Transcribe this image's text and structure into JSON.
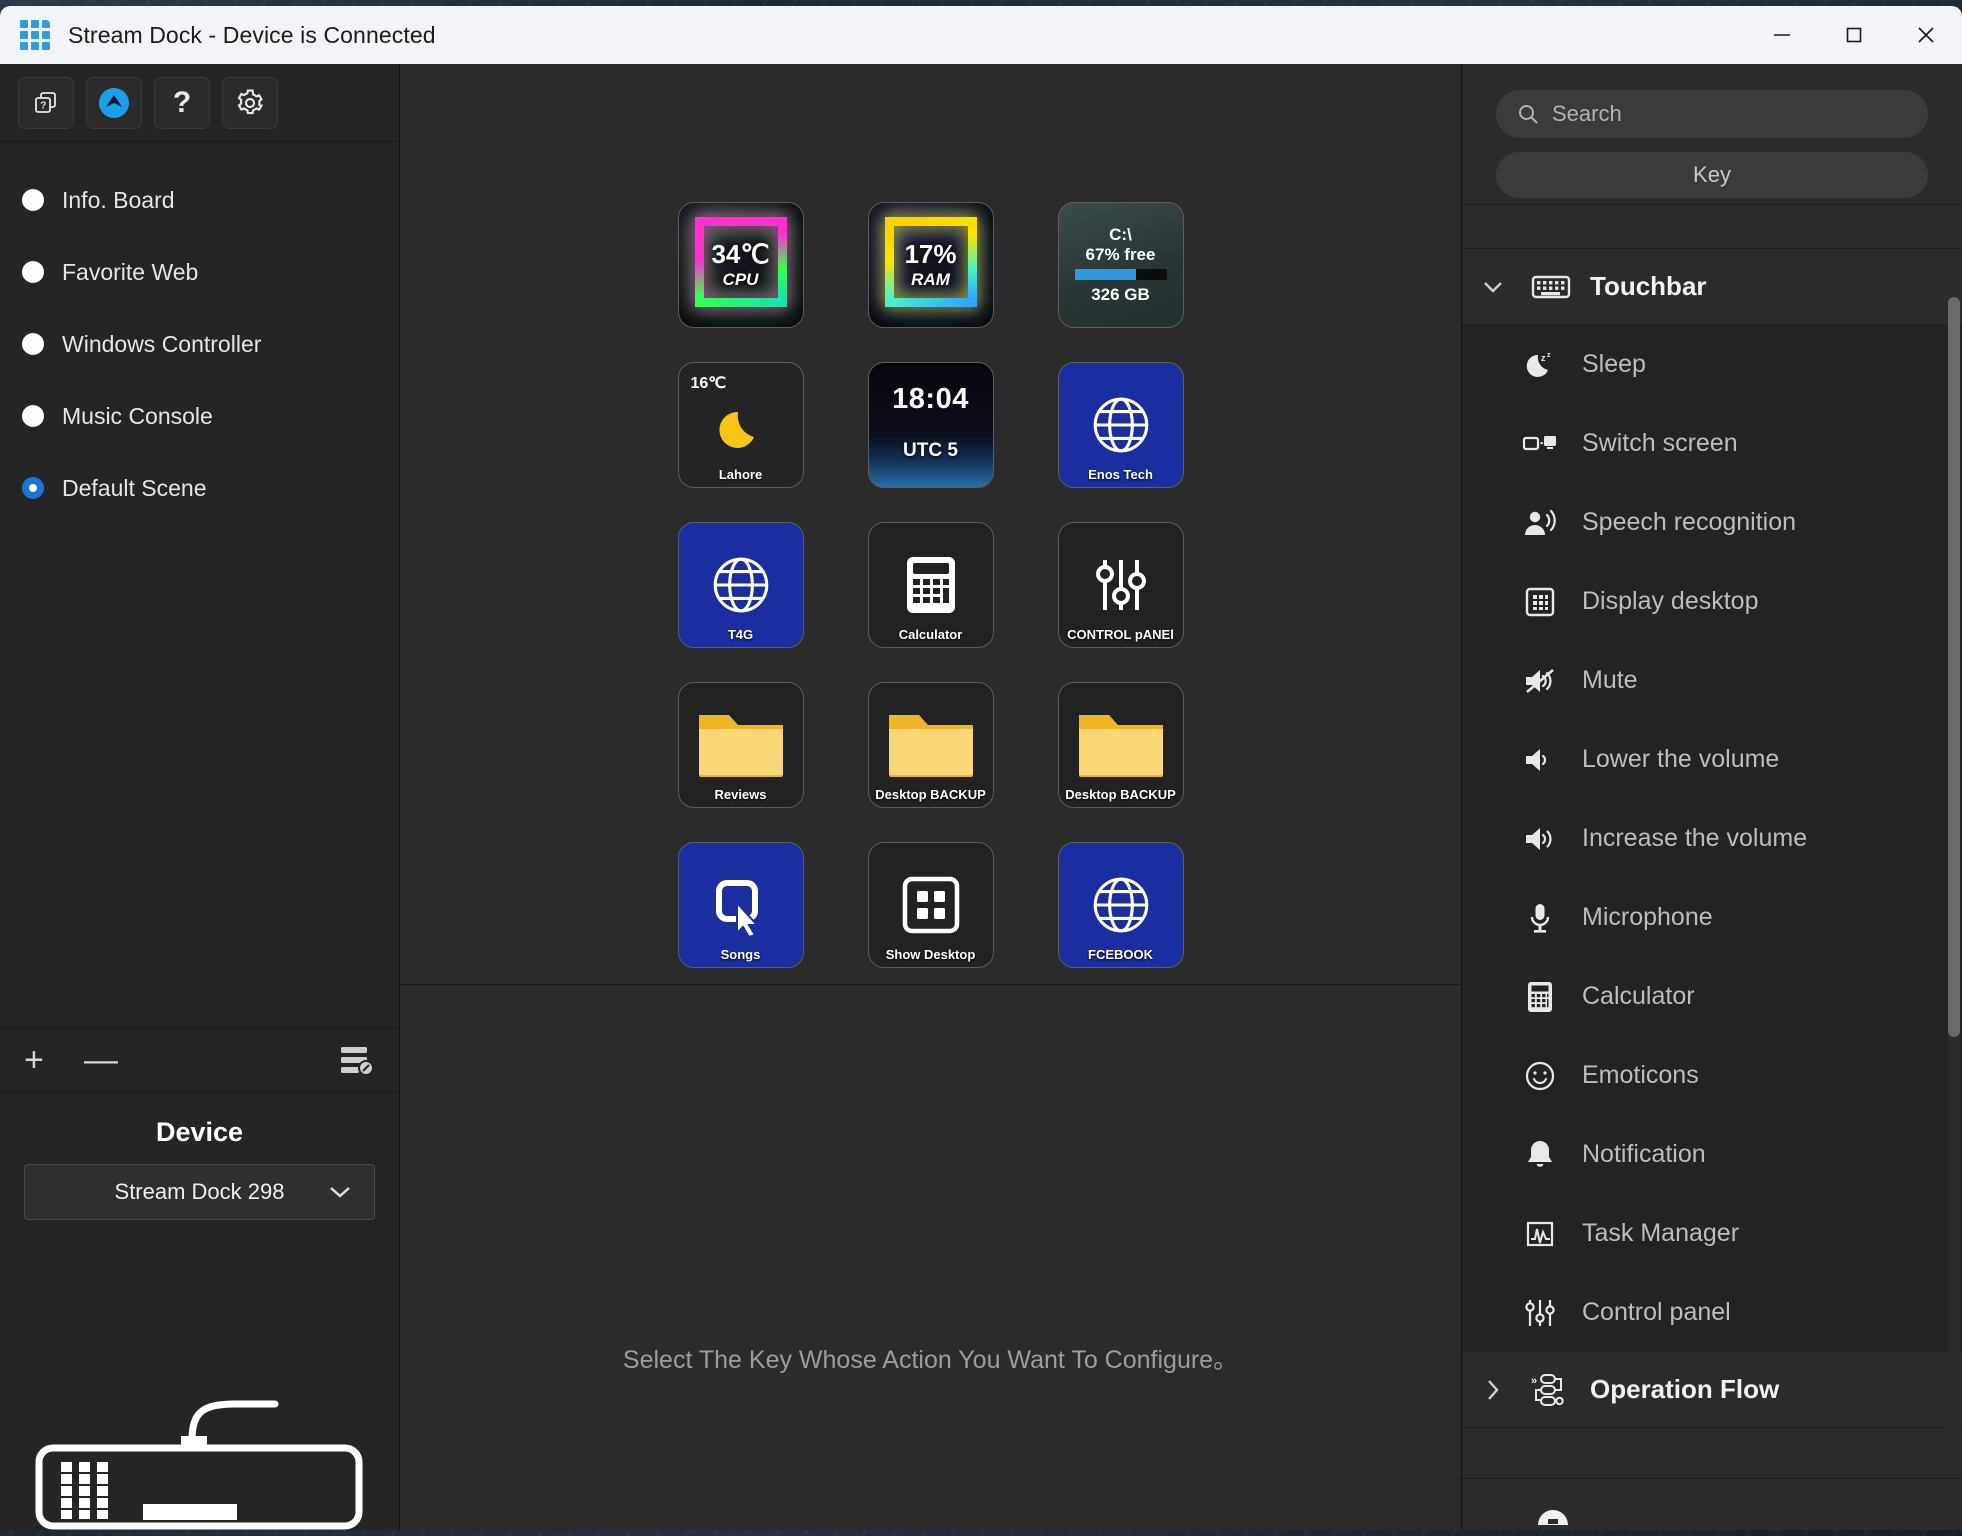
{
  "window": {
    "title": "Stream Dock - Device is Connected",
    "controls": {
      "minimize": "Minimize",
      "maximize": "Maximize",
      "close": "Close"
    }
  },
  "left_panel": {
    "toolbar": [
      {
        "name": "device-copy-button",
        "icon": "copy-device-icon",
        "label": ""
      },
      {
        "name": "update-button",
        "icon": "arrow-up-circle-icon",
        "label": ""
      },
      {
        "name": "help-button",
        "icon": "question-mark-icon",
        "label": "?"
      },
      {
        "name": "settings-button",
        "icon": "gear-icon",
        "label": ""
      }
    ],
    "scenes": [
      {
        "label": "Info. Board",
        "selected": false
      },
      {
        "label": "Favorite Web",
        "selected": false
      },
      {
        "label": "Windows Controller",
        "selected": false
      },
      {
        "label": "Music Console",
        "selected": false
      },
      {
        "label": "Default Scene",
        "selected": true
      }
    ],
    "actions": {
      "add": "+",
      "remove": "—",
      "manage_icon": "list-edit-icon"
    },
    "device": {
      "title": "Device",
      "selected": "Stream Dock 298",
      "options": [
        "Stream Dock 298"
      ],
      "art": "keyboard-illustration"
    }
  },
  "center_panel": {
    "hint": "Select The Key Whose Action You Want To Configure。",
    "keys": [
      {
        "pos": "r1c1",
        "type": "neon-cpu",
        "value": "34℃",
        "sub": "CPU",
        "label": ""
      },
      {
        "pos": "r1c2",
        "type": "neon-ram",
        "value": "17%",
        "sub": "RAM",
        "label": ""
      },
      {
        "pos": "r1c3",
        "type": "disk",
        "drive": "C:\\",
        "free": "67% free",
        "size": "326 GB",
        "percent": 67,
        "label": ""
      },
      {
        "pos": "r2c1",
        "type": "weather",
        "value": "16℃",
        "icon": "moon-icon",
        "label": "Lahore"
      },
      {
        "pos": "r2c2",
        "type": "clock",
        "value": "18:04",
        "sub": "UTC 5",
        "label": ""
      },
      {
        "pos": "r2c3",
        "type": "web",
        "icon": "globe-icon",
        "label": "Enos Tech"
      },
      {
        "pos": "r3c1",
        "type": "web",
        "icon": "globe-icon",
        "label": "T4G"
      },
      {
        "pos": "r3c2",
        "type": "app",
        "icon": "calculator-icon",
        "label": "Calculator"
      },
      {
        "pos": "r3c3",
        "type": "app",
        "icon": "sliders-icon",
        "label": "CONTROL pANEl"
      },
      {
        "pos": "r4c1",
        "type": "folder",
        "icon": "folder-icon",
        "label": "Reviews"
      },
      {
        "pos": "r4c2",
        "type": "folder",
        "icon": "folder-icon",
        "label": "Desktop BACKUP"
      },
      {
        "pos": "r4c3",
        "type": "folder",
        "icon": "folder-icon",
        "label": "Desktop BACKUP"
      },
      {
        "pos": "r5c1",
        "type": "shortcut",
        "icon": "cursor-click-icon",
        "label": "Songs"
      },
      {
        "pos": "r5c2",
        "type": "app",
        "icon": "show-desktop-icon",
        "label": "Show Desktop"
      },
      {
        "pos": "r5c3",
        "type": "web",
        "icon": "globe-icon",
        "label": "FCEBOOK"
      }
    ]
  },
  "right_panel": {
    "search": {
      "placeholder": "Search",
      "value": ""
    },
    "key_tab": "Key",
    "categories": [
      {
        "name": "Touchbar",
        "icon": "keyboard-icon",
        "expanded": true,
        "items": [
          {
            "label": "Sleep",
            "icon": "moon-zz-icon"
          },
          {
            "label": "Switch screen",
            "icon": "switch-screen-icon"
          },
          {
            "label": "Speech recognition",
            "icon": "speech-recognition-icon"
          },
          {
            "label": "Display desktop",
            "icon": "display-desktop-icon"
          },
          {
            "label": "Mute",
            "icon": "mute-icon"
          },
          {
            "label": "Lower the volume",
            "icon": "volume-down-icon"
          },
          {
            "label": "Increase the volume",
            "icon": "volume-up-icon"
          },
          {
            "label": "Microphone",
            "icon": "microphone-icon"
          },
          {
            "label": "Calculator",
            "icon": "calculator-icon"
          },
          {
            "label": "Emoticons",
            "icon": "smiley-icon"
          },
          {
            "label": "Notification",
            "icon": "bell-icon"
          },
          {
            "label": "Task Manager",
            "icon": "task-manager-icon"
          },
          {
            "label": "Control panel",
            "icon": "sliders-icon"
          }
        ]
      },
      {
        "name": "Operation Flow",
        "icon": "flow-icon",
        "expanded": false,
        "items": []
      }
    ]
  }
}
